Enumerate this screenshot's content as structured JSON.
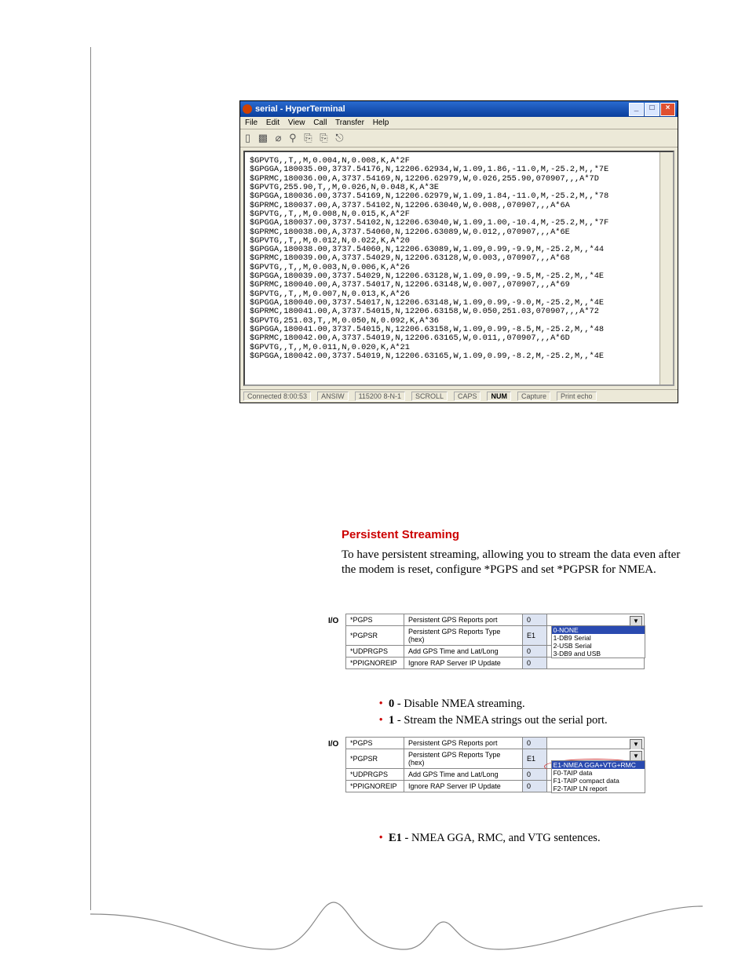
{
  "hyperterminal": {
    "title": "serial - HyperTerminal",
    "menu": [
      "File",
      "Edit",
      "View",
      "Call",
      "Transfer",
      "Help"
    ],
    "toolbar_glyphs": "▯ ▩  ⌀ ⚲  ⎘ ⎘  ⎋",
    "scroll_lines": [
      "$GPVTG,,T,,M,0.004,N,0.008,K,A*2F",
      "$GPGGA,180035.00,3737.54176,N,12206.62934,W,1.09,1.86,-11.0,M,-25.2,M,,*7E",
      "$GPRMC,180036.00,A,3737.54169,N,12206.62979,W,0.026,255.90,070907,,,A*7D",
      "$GPVTG,255.90,T,,M,0.026,N,0.048,K,A*3E",
      "$GPGGA,180036.00,3737.54169,N,12206.62979,W,1.09,1.84,-11.0,M,-25.2,M,,*78",
      "$GPRMC,180037.00,A,3737.54102,N,12206.63040,W,0.008,,070907,,,A*6A",
      "$GPVTG,,T,,M,0.008,N,0.015,K,A*2F",
      "$GPGGA,180037.00,3737.54102,N,12206.63040,W,1.09,1.00,-10.4,M,-25.2,M,,*7F",
      "$GPRMC,180038.00,A,3737.54060,N,12206.63089,W,0.012,,070907,,,A*6E",
      "$GPVTG,,T,,M,0.012,N,0.022,K,A*20",
      "$GPGGA,180038.00,3737.54060,N,12206.63089,W,1.09,0.99,-9.9,M,-25.2,M,,*44",
      "$GPRMC,180039.00,A,3737.54029,N,12206.63128,W,0.003,,070907,,,A*68",
      "$GPVTG,,T,,M,0.003,N,0.006,K,A*26",
      "$GPGGA,180039.00,3737.54029,N,12206.63128,W,1.09,0.99,-9.5,M,-25.2,M,,*4E",
      "$GPRMC,180040.00,A,3737.54017,N,12206.63148,W,0.007,,070907,,,A*69",
      "$GPVTG,,T,,M,0.007,N,0.013,K,A*26",
      "$GPGGA,180040.00,3737.54017,N,12206.63148,W,1.09,0.99,-9.0,M,-25.2,M,,*4E",
      "$GPRMC,180041.00,A,3737.54015,N,12206.63158,W,0.050,251.03,070907,,,A*72",
      "$GPVTG,251.03,T,,M,0.050,N,0.092,K,A*36",
      "$GPGGA,180041.00,3737.54015,N,12206.63158,W,1.09,0.99,-8.5,M,-25.2,M,,*48",
      "$GPRMC,180042.00,A,3737.54019,N,12206.63165,W,0.011,,070907,,,A*6D",
      "$GPVTG,,T,,M,0.011,N,0.020,K,A*21",
      "$GPGGA,180042.00,3737.54019,N,12206.63165,W,1.09,0.99,-8.2,M,-25.2,M,,*4E"
    ],
    "status": {
      "connected": "Connected 8:00:53",
      "det": "ANSIW",
      "baud": "115200 8-N-1",
      "flags": [
        "SCROLL",
        "CAPS",
        "NUM",
        "Capture",
        "Print echo"
      ]
    }
  },
  "section_title": "Persistent Streaming",
  "body_para": "To have persistent streaming, allowing you to stream the data even after the modem is reset, configure *PGPS and set *PGPSR for NMEA.",
  "io_label": "I/O",
  "config_table_1": {
    "rows": [
      {
        "key": "*PGPS",
        "desc": "Persistent GPS Reports port",
        "val": "0"
      },
      {
        "key": "*PGPSR",
        "desc": "Persistent GPS Reports Type (hex)",
        "val": "E1"
      },
      {
        "key": "*UDPRGPS",
        "desc": "Add GPS Time and Lat/Long",
        "val": "0"
      },
      {
        "key": "*PPIGNOREIP",
        "desc": "Ignore RAP Server IP Update",
        "val": "0"
      }
    ],
    "dropdown": [
      "0-NONE",
      "1-DB9 Serial",
      "2-USB Serial",
      "3-DB9 and USB"
    ],
    "dropdown_selected": 0
  },
  "bullets_1": [
    {
      "key": "0",
      "text": " - Disable NMEA streaming."
    },
    {
      "key": "1",
      "text": " - Stream the NMEA strings out the serial port."
    }
  ],
  "config_table_2": {
    "rows": [
      {
        "key": "*PGPS",
        "desc": "Persistent GPS Reports port",
        "val": "0"
      },
      {
        "key": "*PGPSR",
        "desc": "Persistent GPS Reports Type (hex)",
        "val": "E1"
      },
      {
        "key": "*UDPRGPS",
        "desc": "Add GPS Time and Lat/Long",
        "val": "0"
      },
      {
        "key": "*PPIGNOREIP",
        "desc": "Ignore RAP Server IP Update",
        "val": "0"
      }
    ],
    "dropdown": [
      "E1-NMEA GGA+VTG+RMC",
      "F0-TAIP data",
      "F1-TAIP compact data",
      "F2-TAIP LN report"
    ],
    "dropdown_selected": 0
  },
  "bullets_2": [
    {
      "key": "E1",
      "text": " - NMEA GGA, RMC, and VTG sentences."
    }
  ],
  "window_controls": {
    "min": "_",
    "max": "□",
    "close": "×"
  }
}
